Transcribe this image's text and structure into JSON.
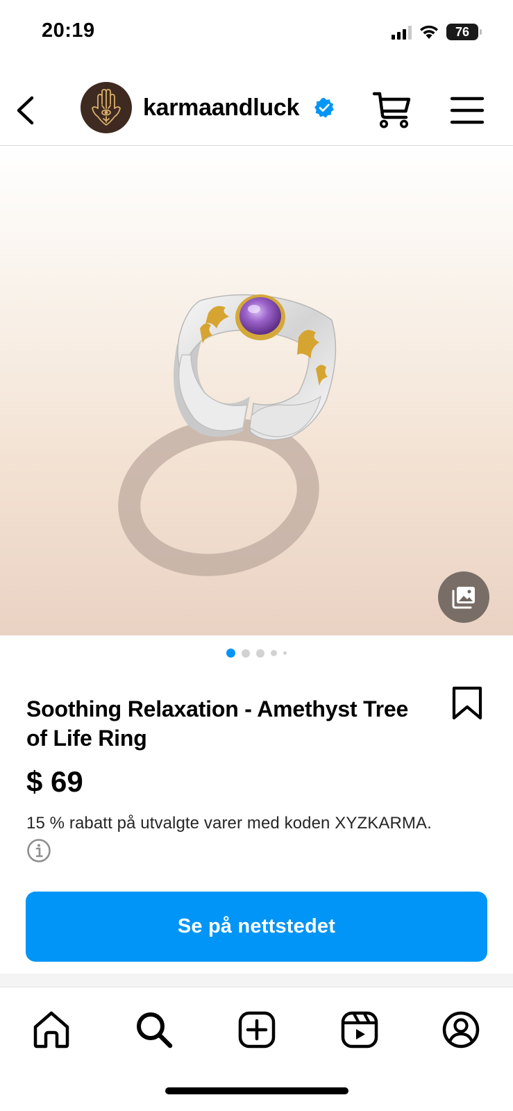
{
  "status_bar": {
    "time": "20:19",
    "battery": "76",
    "icons": [
      "cellular-signal-icon",
      "wifi-icon",
      "battery-icon"
    ]
  },
  "header": {
    "username": "karmaandluck",
    "verified": true,
    "icons": [
      "back-arrow-icon",
      "hamsa-hand-logo",
      "verified-badge-icon",
      "cart-icon",
      "hamburger-menu-icon"
    ]
  },
  "carousel": {
    "total_dots": 5,
    "active_index": 0,
    "gallery_icon": "image-gallery-icon"
  },
  "product": {
    "title": "Soothing Relaxation - Amethyst Tree of Life Ring",
    "price": "$ 69",
    "promo": "15 % rabatt på utvalgte varer med koden XYZKARMA.",
    "bookmark_icon": "bookmark-icon",
    "info_icon": "info-icon"
  },
  "cta": {
    "label": "Se på nettstedet"
  },
  "bottom_nav": {
    "items": [
      "home-icon",
      "search-icon",
      "create-post-icon",
      "reels-icon",
      "profile-icon"
    ]
  },
  "colors": {
    "accent": "#0095f6",
    "verified": "#0095f6",
    "avatar_bg": "#3f2a22",
    "text": "#000000"
  }
}
